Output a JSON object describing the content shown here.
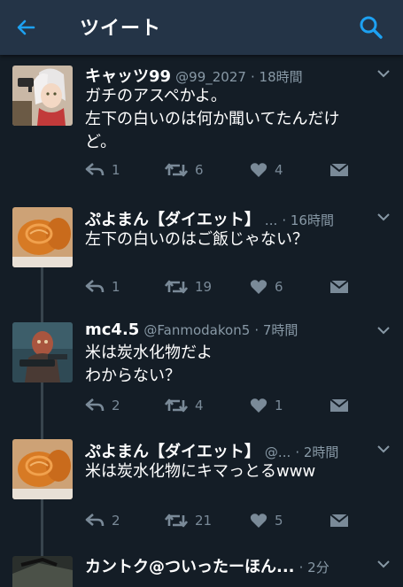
{
  "header": {
    "back_icon": "arrow-left-icon",
    "title": "ツイート",
    "search_icon": "search-icon",
    "background": "#243447",
    "accent": "#1da1f2"
  },
  "tweets": [
    {
      "name": "キャッツ99",
      "handle": "@99_2027",
      "time": "· 18時間",
      "lines": [
        "ガチのアスペかよ。",
        "左下の白いのは何か聞いてたんだけ",
        "ど。"
      ],
      "counts": {
        "reply": "1",
        "retweet": "6",
        "like": "4"
      }
    },
    {
      "name": "ぷよまん【ダイエット】",
      "handle": "...",
      "time": "· 16時間",
      "lines": [
        "左下の白いのはご飯じゃない？"
      ],
      "counts": {
        "reply": "1",
        "retweet": "19",
        "like": "6"
      }
    },
    {
      "name": "mc4.5",
      "handle": "@Fanmodakon5",
      "time": "· 7時間",
      "lines": [
        "米は炭水化物だよ",
        "わからない？"
      ],
      "counts": {
        "reply": "2",
        "retweet": "4",
        "like": "1"
      }
    },
    {
      "name": "ぷよまん【ダイエット】",
      "handle": "@...",
      "time": "· 2時間",
      "lines": [
        "米は炭水化物にキマっとるwww"
      ],
      "counts": {
        "reply": "2",
        "retweet": "21",
        "like": "5"
      }
    },
    {
      "name": "カントク@ついったーほん...",
      "handle": "",
      "time": "· 2分",
      "lines": [],
      "counts": {}
    }
  ]
}
